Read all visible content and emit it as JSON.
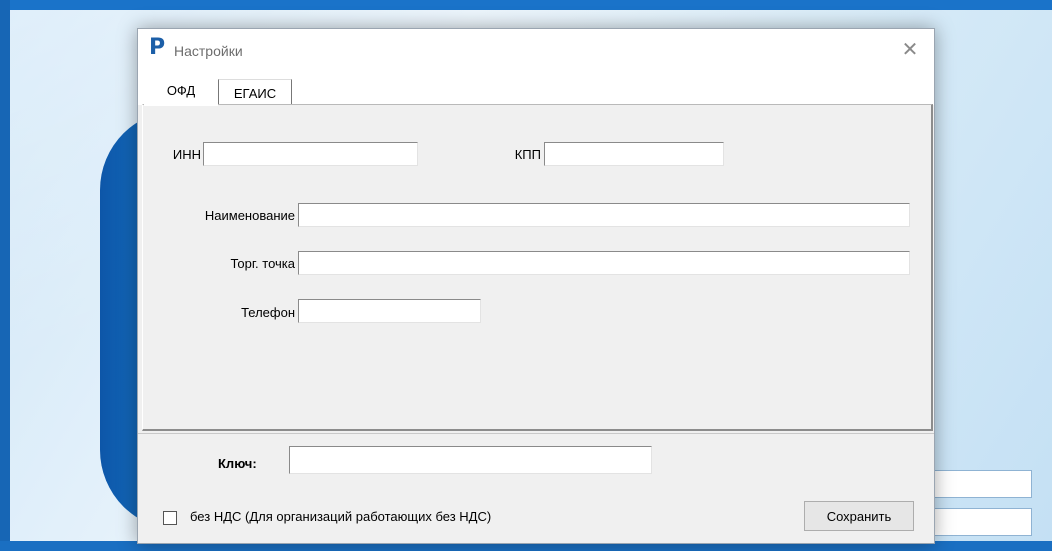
{
  "window": {
    "title": "Настройки",
    "app_icon_glyph": "P",
    "close_glyph": "✕"
  },
  "tabs": [
    {
      "label": "ОФД",
      "active": true
    },
    {
      "label": "ЕГАИС",
      "active": false
    }
  ],
  "ofd_form": {
    "inn": {
      "label": "ИНН",
      "value": ""
    },
    "kpp": {
      "label": "КПП",
      "value": ""
    },
    "name": {
      "label": "Наименование",
      "value": ""
    },
    "store": {
      "label": "Торг. точка",
      "value": ""
    },
    "phone": {
      "label": "Телефон",
      "value": ""
    }
  },
  "footer": {
    "key": {
      "label": "Ключ:",
      "value": ""
    },
    "no_vat": {
      "label": "без НДС (Для организаций работающих без НДС)",
      "checked": false
    },
    "save_label": "Сохранить"
  },
  "colors": {
    "accent": "#1c5fa8",
    "dialog_bg": "#f0f0f0"
  }
}
